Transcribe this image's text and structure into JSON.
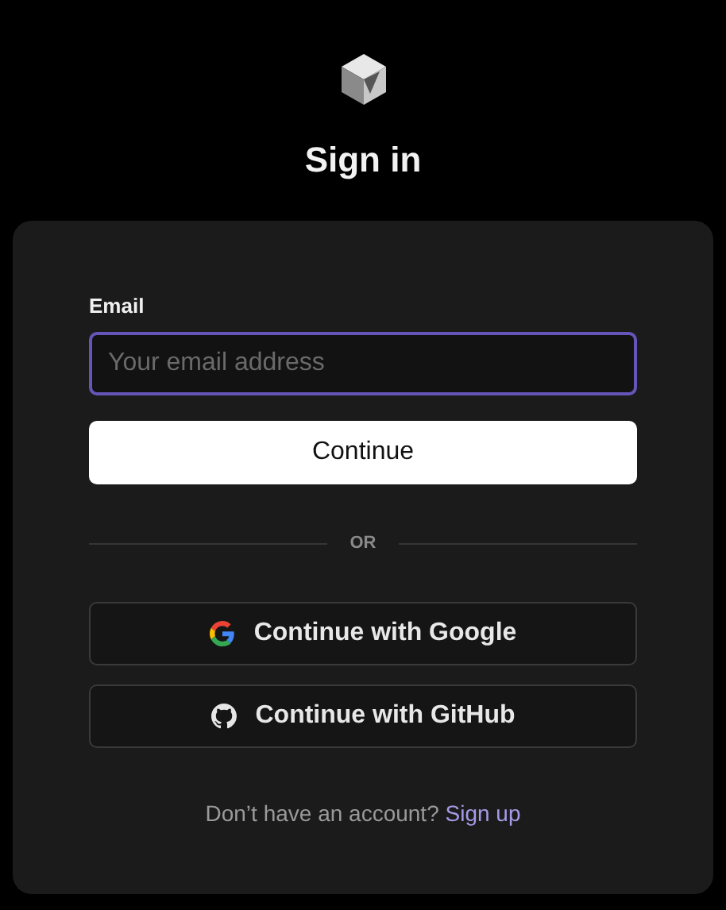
{
  "title": "Sign in",
  "email": {
    "label": "Email",
    "placeholder": "Your email address",
    "focused": true
  },
  "continue_button": "Continue",
  "divider": "OR",
  "providers": [
    {
      "kind": "google",
      "label": "Continue with Google"
    },
    {
      "kind": "github",
      "label": "Continue with GitHub"
    }
  ],
  "footer": {
    "text": "Don’t have an account?",
    "link": "Sign up"
  }
}
